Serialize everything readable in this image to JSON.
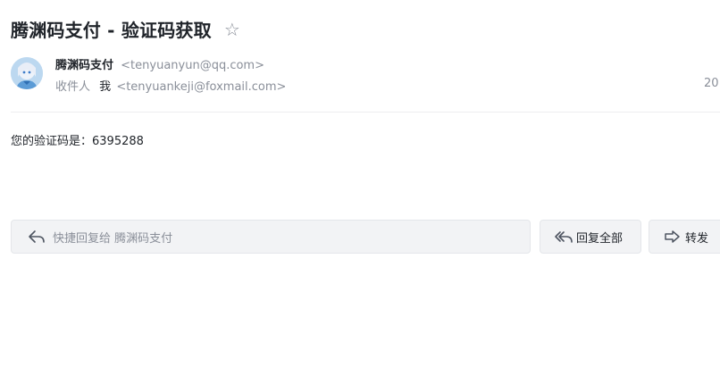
{
  "email": {
    "subject": "腾渊码支付 - 验证码获取",
    "star_icon": "star-outline-icon",
    "sender": {
      "name": "腾渊码支付",
      "email": "<tenyuanyun@qq.com>"
    },
    "recipient": {
      "label": "收件人",
      "name": "我",
      "email": "<tenyuankeji@foxmail.com>"
    },
    "date": "20",
    "body": "您的验证码是：6395288"
  },
  "actions": {
    "quick_reply_placeholder": "快捷回复给 腾渊码支付",
    "reply_all_label": "回复全部",
    "forward_label": "转发"
  },
  "colors": {
    "text_primary": "#1f2329",
    "text_secondary": "#8a8f99",
    "button_bg": "#f2f3f5"
  }
}
